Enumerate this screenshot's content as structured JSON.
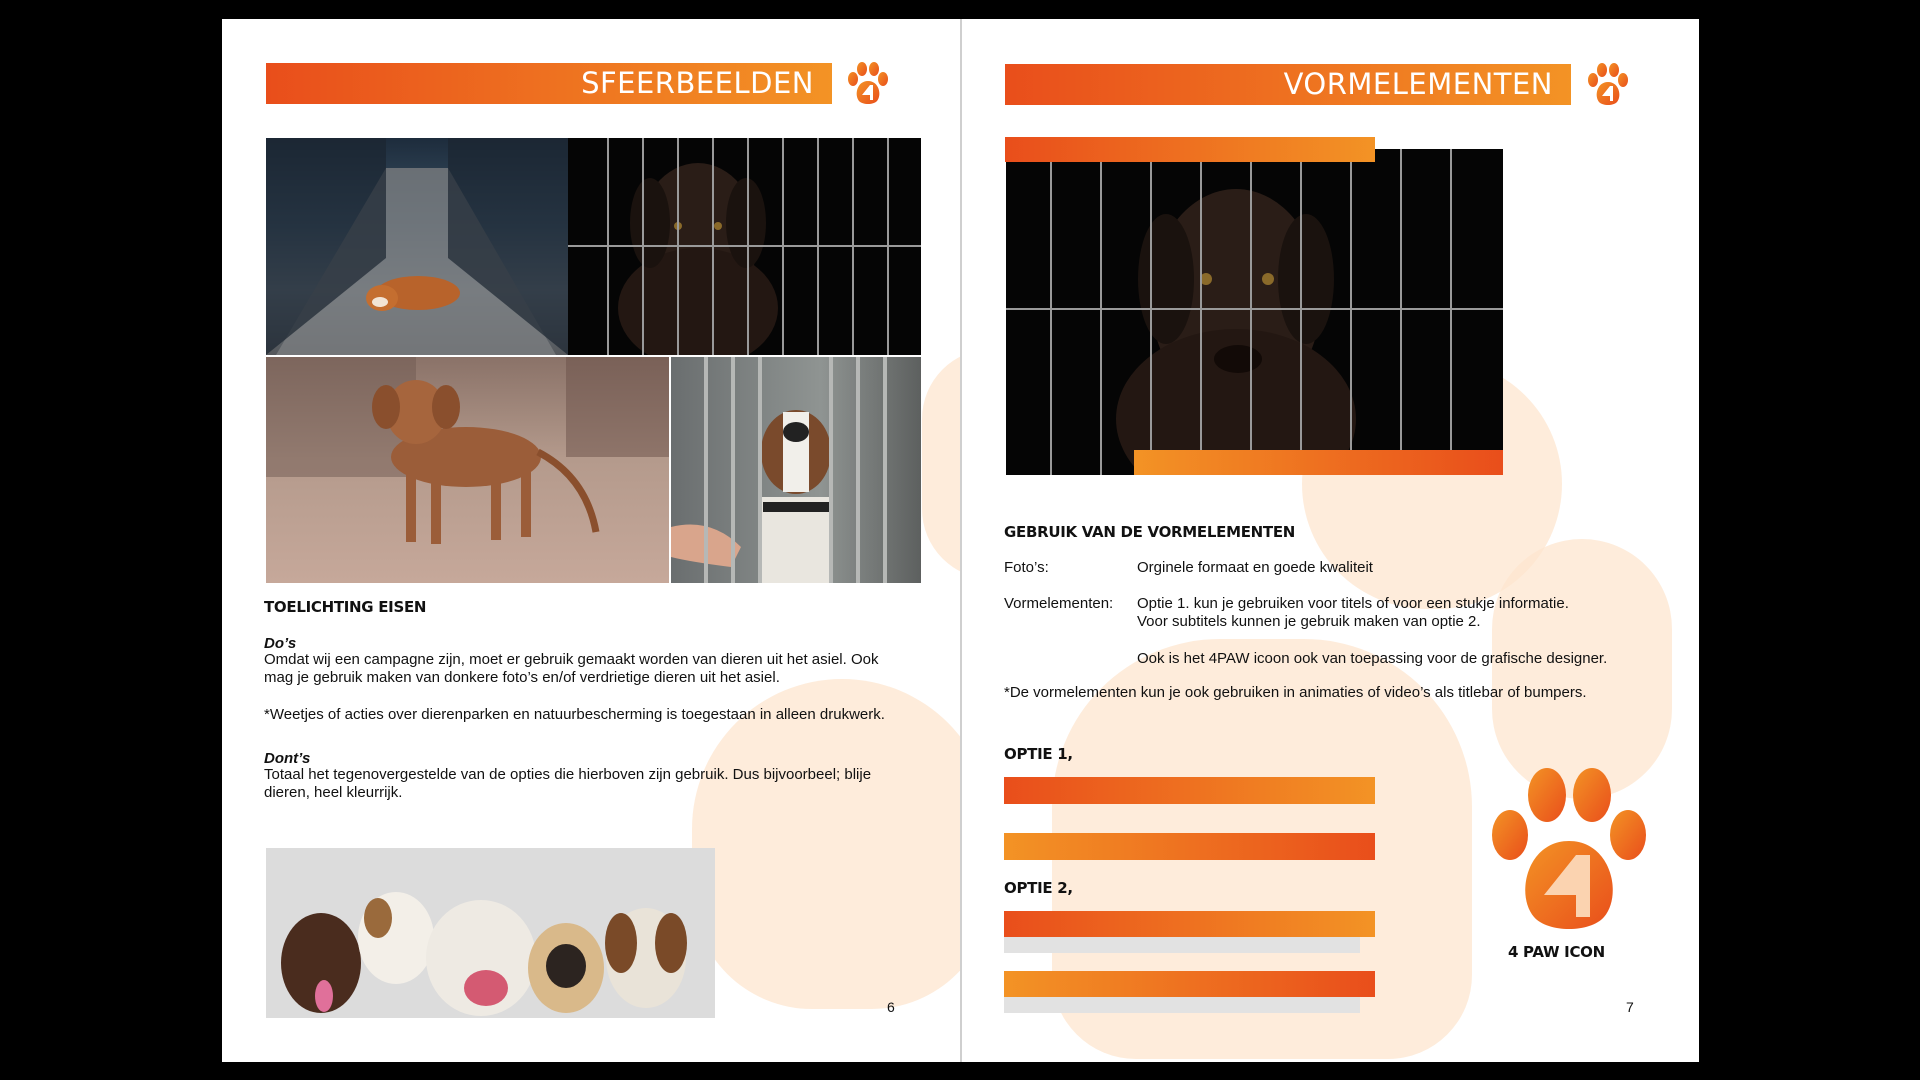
{
  "left_page": {
    "title": "SFEERBEELDEN",
    "section_heading": "TOELICHTING EISEN",
    "dos_label": "Do’s",
    "dos_text_1": "Omdat wij een campagne zijn, moet er gebruik gemaakt worden van dieren uit het asiel. Ook",
    "dos_text_2": "mag je gebruik maken van donkere foto’s en/of verdrietige dieren uit het asiel.",
    "note": "*Weetjes of acties over dierenparken en natuurbescherming is toegestaan in alleen drukwerk.",
    "donts_label": "Dont’s",
    "donts_text_1": "Totaal het tegenovergestelde van de opties die hierboven zijn gebruik. Dus bijvoorbeel; blije",
    "donts_text_2": "dieren, heel kleurrijk.",
    "page_number": "6"
  },
  "right_page": {
    "title": "VORMELEMENTEN",
    "section_heading": "GEBRUIK VAN DE VORMELEMENTEN",
    "photos_label": "Foto’s:",
    "photos_value": "Orginele formaat en goede kwaliteit",
    "elements_label": "Vormelementen:",
    "elements_value_1": "Optie 1.  kun je gebruiken voor titels of voor een stukje informatie.",
    "elements_value_2": "Voor subtitels kunnen je gebruik maken van optie 2.",
    "elements_value_3": "Ook is het 4PAW icoon ook van toepassing voor de grafische designer.",
    "footnote": "*De vormelementen kun je ook gebruiken in animaties of video’s als titlebar of bumpers.",
    "option1_label": "OPTIE 1,",
    "option2_label": "OPTIE 2,",
    "icon_caption": "4 PAW ICON",
    "page_number": "7"
  },
  "colors": {
    "orange_dark": "#e94e1b",
    "orange_light": "#f39325",
    "blob": "#fde6cf",
    "grey_bar": "#e2e2e2"
  }
}
